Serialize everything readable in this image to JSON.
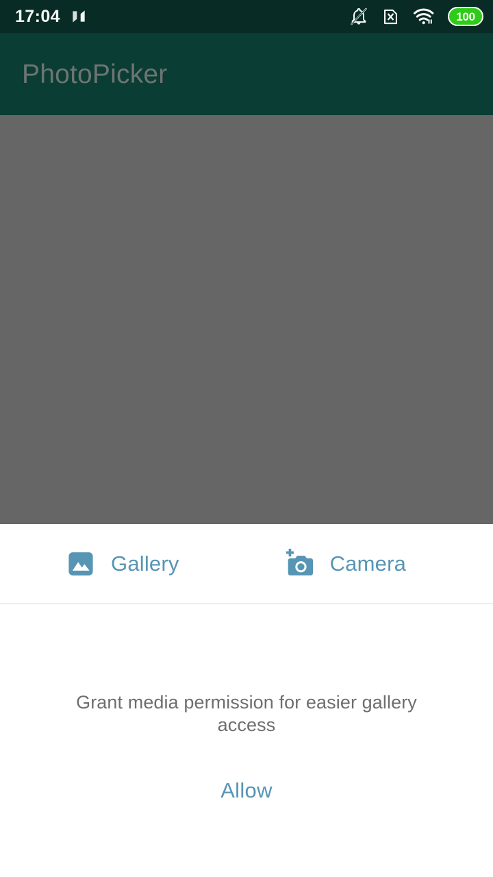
{
  "status_bar": {
    "time": "17:04",
    "logo_icon": "nova-n-icon",
    "icons": [
      {
        "name": "notifications-muted-icon",
        "label": "Notifications silenced"
      },
      {
        "name": "no-sim-icon",
        "label": "No SIM card"
      },
      {
        "name": "wifi-icon",
        "label": "Wi-Fi connected"
      }
    ],
    "battery": {
      "icon": "battery-icon",
      "level": "100",
      "fill_color": "#2ecc18",
      "text_color": "#ffffff"
    },
    "background_color": "#082b25"
  },
  "app_bar": {
    "title": "PhotoPicker",
    "background_color": "#0a3d33",
    "title_color": "#6d7573"
  },
  "content": {
    "scrim_color": "#666666"
  },
  "bottom_sheet": {
    "background_color": "#ffffff",
    "corner_radius_px": 32,
    "divider_color": "#eceded",
    "accent_color": "#5795b5",
    "sources": [
      {
        "id": "gallery",
        "label": "Gallery",
        "icon": "image-icon"
      },
      {
        "id": "camera",
        "label": "Camera",
        "icon": "add-a-photo-icon"
      }
    ],
    "permission": {
      "message": "Grant media permission for easier gallery access",
      "message_color": "#6e6e6e",
      "action_label": "Allow"
    }
  }
}
